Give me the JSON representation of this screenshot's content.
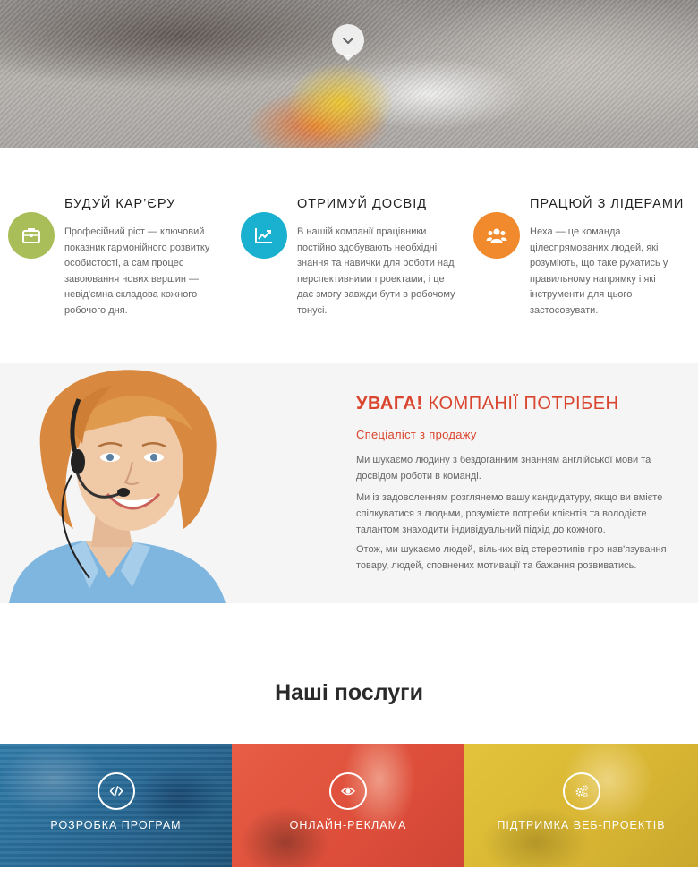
{
  "hero": {
    "scroll_icon": "chevron-down-icon"
  },
  "features": [
    {
      "title": "БУДУЙ КАР’ЄРУ",
      "icon": "briefcase-icon",
      "color": "#a9bd58",
      "text": "Професійний ріст — ключовий показник гармонійного розвитку особистості, а сам процес завоювання нових вершин — невід'ємна складова кожного робочого дня."
    },
    {
      "title": "ОТРИМУЙ ДОСВІД",
      "icon": "chart-line-icon",
      "color": "#1ab0cf",
      "text": "В нашій компанії працівники постійно здобувають необхідні знання та навички для роботи над перспективними проектами, і це дає змогу завжди бути в робочому тонусі."
    },
    {
      "title": "ПРАЦЮЙ З ЛІДЕРАМИ",
      "icon": "users-icon",
      "color": "#f08a2c",
      "text": "Hexa — це команда цілеспрямованих людей, які розуміють, що таке рухатись у правильному напрямку і які інструменти для цього застосовувати."
    }
  ],
  "attention": {
    "title_bold": "УВАГА!",
    "title_rest": " КОМПАНІЇ ПОТРІБЕН",
    "subtitle": "Спеціаліст з продажу",
    "paragraphs": [
      "Ми шукаємо людину з бездоганним знанням англійської мови та досвідом роботи в команді.",
      "Ми із задоволенням розглянемо вашу кандидатуру, якщо ви вмієте спілкуватися з людьми, розумієте потреби клієнтів та володієте талантом знаходити індивідуальний підхід до кожного.",
      "Отож, ми шукаємо людей, вільних від стереотипів про нав'язування товару, людей, сповнених мотивації та бажання розвиватись."
    ],
    "accent_color": "#d9452e"
  },
  "services": {
    "title": "Наші послуги",
    "items": [
      {
        "label": "РОЗРОБКА ПРОГРАМ",
        "icon": "code-icon",
        "color": "#2f7aa8"
      },
      {
        "label": "ОНЛАЙН-РЕКЛАМА",
        "icon": "eye-icon",
        "color": "#e75d45"
      },
      {
        "label": "ПІДТРИМКА ВЕБ-ПРОЕКТІВ",
        "icon": "gears-icon",
        "color": "#e2c33a"
      }
    ]
  }
}
